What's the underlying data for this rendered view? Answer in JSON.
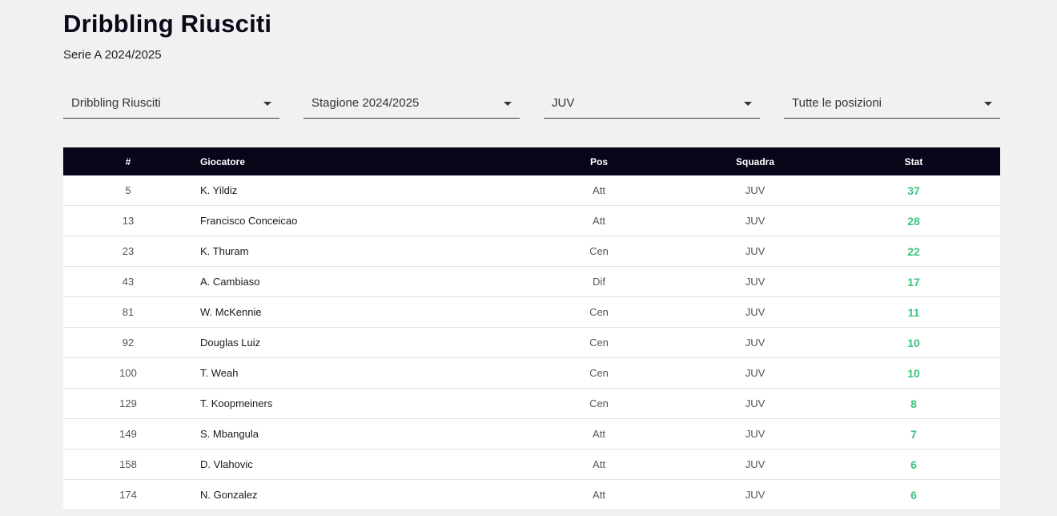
{
  "header": {
    "title": "Dribbling Riusciti",
    "subtitle": "Serie A 2024/2025"
  },
  "filters": [
    {
      "value": "Dribbling Riusciti"
    },
    {
      "value": "Stagione 2024/2025"
    },
    {
      "value": "JUV"
    },
    {
      "value": "Tutte le posizioni"
    }
  ],
  "table": {
    "columns": [
      "#",
      "Giocatore",
      "Pos",
      "Squadra",
      "Stat"
    ],
    "rows": [
      {
        "rank": "5",
        "player": "K. Yildiz",
        "pos": "Att",
        "team": "JUV",
        "stat": "37"
      },
      {
        "rank": "13",
        "player": "Francisco Conceicao",
        "pos": "Att",
        "team": "JUV",
        "stat": "28"
      },
      {
        "rank": "23",
        "player": "K. Thuram",
        "pos": "Cen",
        "team": "JUV",
        "stat": "22"
      },
      {
        "rank": "43",
        "player": "A. Cambiaso",
        "pos": "Dif",
        "team": "JUV",
        "stat": "17"
      },
      {
        "rank": "81",
        "player": "W. McKennie",
        "pos": "Cen",
        "team": "JUV",
        "stat": "11"
      },
      {
        "rank": "92",
        "player": "Douglas Luiz",
        "pos": "Cen",
        "team": "JUV",
        "stat": "10"
      },
      {
        "rank": "100",
        "player": "T. Weah",
        "pos": "Cen",
        "team": "JUV",
        "stat": "10"
      },
      {
        "rank": "129",
        "player": "T. Koopmeiners",
        "pos": "Cen",
        "team": "JUV",
        "stat": "8"
      },
      {
        "rank": "149",
        "player": "S. Mbangula",
        "pos": "Att",
        "team": "JUV",
        "stat": "7"
      },
      {
        "rank": "158",
        "player": "D. Vlahovic",
        "pos": "Att",
        "team": "JUV",
        "stat": "6"
      },
      {
        "rank": "174",
        "player": "N. Gonzalez",
        "pos": "Att",
        "team": "JUV",
        "stat": "6"
      }
    ]
  },
  "colors": {
    "header_bg": "#0a0418",
    "stat_accent": "#3cc47c",
    "page_bg": "#f1f1f1"
  }
}
